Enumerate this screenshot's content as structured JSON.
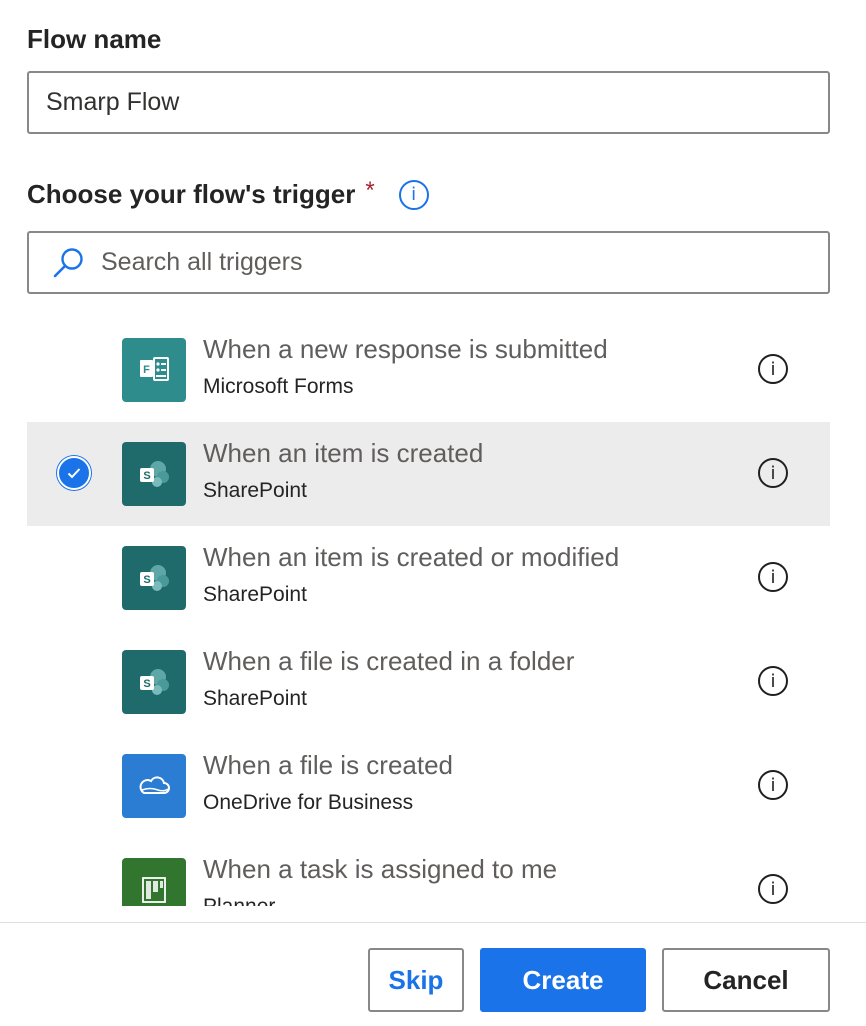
{
  "flow_name": {
    "label": "Flow name",
    "value": "Smarp Flow"
  },
  "trigger": {
    "label": "Choose your flow's trigger",
    "required_marker": "*",
    "info_glyph": "i",
    "search_placeholder": "Search all triggers",
    "items": [
      {
        "title": "When a new response is submitted",
        "connector": "Microsoft Forms",
        "icon": "forms-icon",
        "color": "#2f8c8c",
        "selected": false
      },
      {
        "title": "When an item is created",
        "connector": "SharePoint",
        "icon": "sharepoint-icon",
        "color": "#1f6b6b",
        "selected": true
      },
      {
        "title": "When an item is created or modified",
        "connector": "SharePoint",
        "icon": "sharepoint-icon",
        "color": "#1f6b6b",
        "selected": false
      },
      {
        "title": "When a file is created in a folder",
        "connector": "SharePoint",
        "icon": "sharepoint-icon",
        "color": "#1f6b6b",
        "selected": false
      },
      {
        "title": "When a file is created",
        "connector": "OneDrive for Business",
        "icon": "onedrive-icon",
        "color": "#2b7cd3",
        "selected": false
      },
      {
        "title": "When a task is assigned to me",
        "connector": "Planner",
        "icon": "planner-icon",
        "color": "#31752f",
        "selected": false
      }
    ]
  },
  "buttons": {
    "skip": "Skip",
    "create": "Create",
    "cancel": "Cancel"
  },
  "colors": {
    "accent": "#1a73e8",
    "selected_row": "#ececec",
    "required": "#a4262c"
  }
}
